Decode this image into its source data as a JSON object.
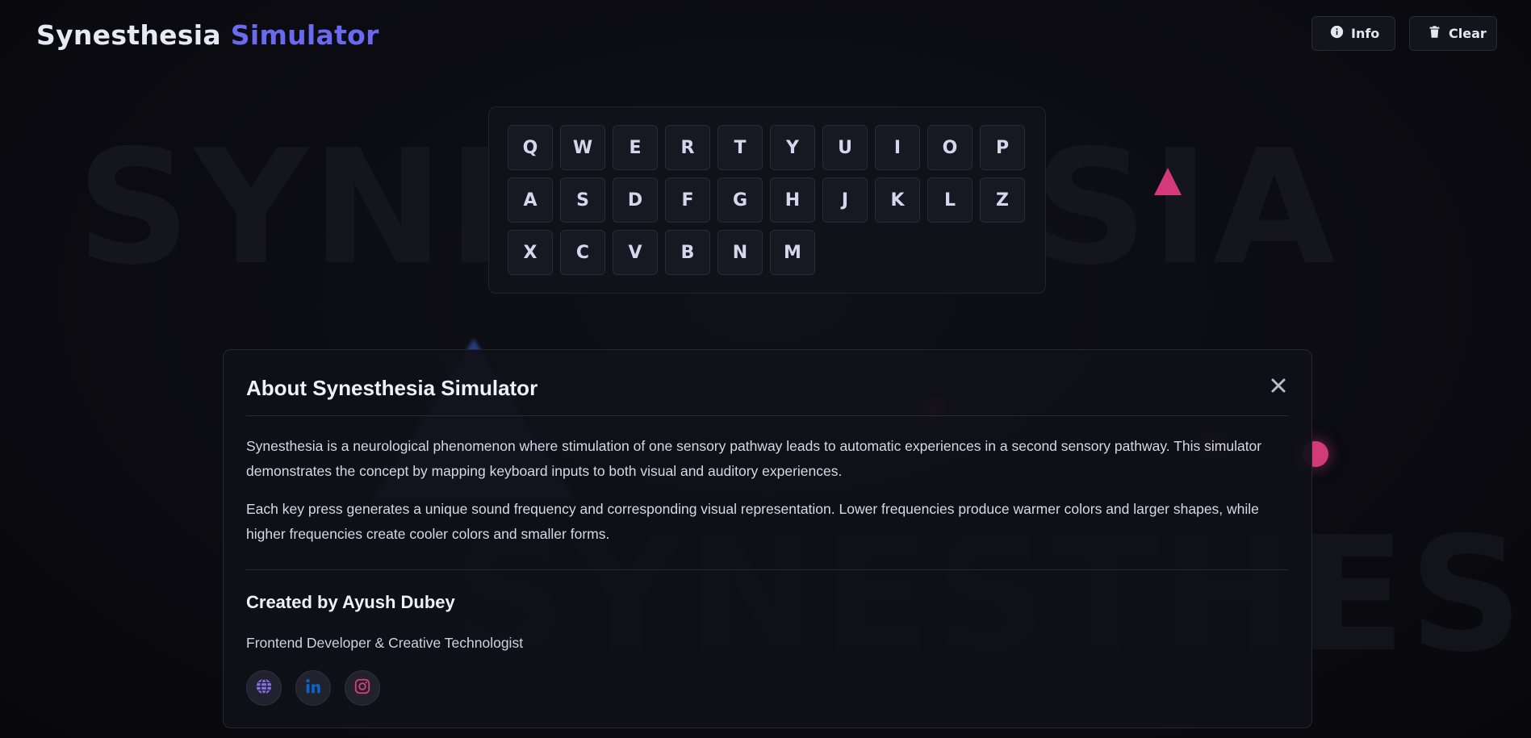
{
  "header": {
    "title_part1": "Synesthesia",
    "title_part2": "Simulator",
    "title_accent_color": "#6a6af0",
    "info_button": {
      "label": "Info",
      "icon": "info-icon"
    },
    "clear_button": {
      "label": "Clear",
      "icon": "trash-icon"
    }
  },
  "background": {
    "watermark_top": "SYNESTHESIA",
    "watermark_bottom": "SYNESTHESIA"
  },
  "keyboard": {
    "rows": [
      [
        "Q",
        "W",
        "E",
        "R",
        "T",
        "Y",
        "U",
        "I",
        "O",
        "P"
      ],
      [
        "A",
        "S",
        "D",
        "F",
        "G",
        "H",
        "J",
        "K",
        "L",
        "Z"
      ],
      [
        "X",
        "C",
        "V",
        "B",
        "N",
        "M"
      ]
    ]
  },
  "modal": {
    "title": "About Synesthesia Simulator",
    "paragraph1": "Synesthesia is a neurological phenomenon where stimulation of one sensory pathway leads to automatic experiences in a second sensory pathway. This simulator demonstrates the concept by mapping keyboard inputs to both visual and auditory experiences.",
    "paragraph2": "Each key press generates a unique sound frequency and corresponding visual representation. Lower frequencies produce warmer colors and larger shapes, while higher frequencies create cooler colors and smaller forms.",
    "creator": "Created by Ayush Dubey",
    "role": "Frontend Developer & Creative Technologist",
    "social_links": [
      {
        "icon": "globe-icon",
        "color": "#8a6ee8"
      },
      {
        "icon": "linkedin-icon",
        "color": "#0a66c2"
      },
      {
        "icon": "instagram-icon",
        "color": "#d6407f"
      }
    ]
  },
  "colors": {
    "background": "#0b0b11",
    "accent": "#6a6af0",
    "pink": "#d4397c",
    "blue": "#3a64d2"
  }
}
